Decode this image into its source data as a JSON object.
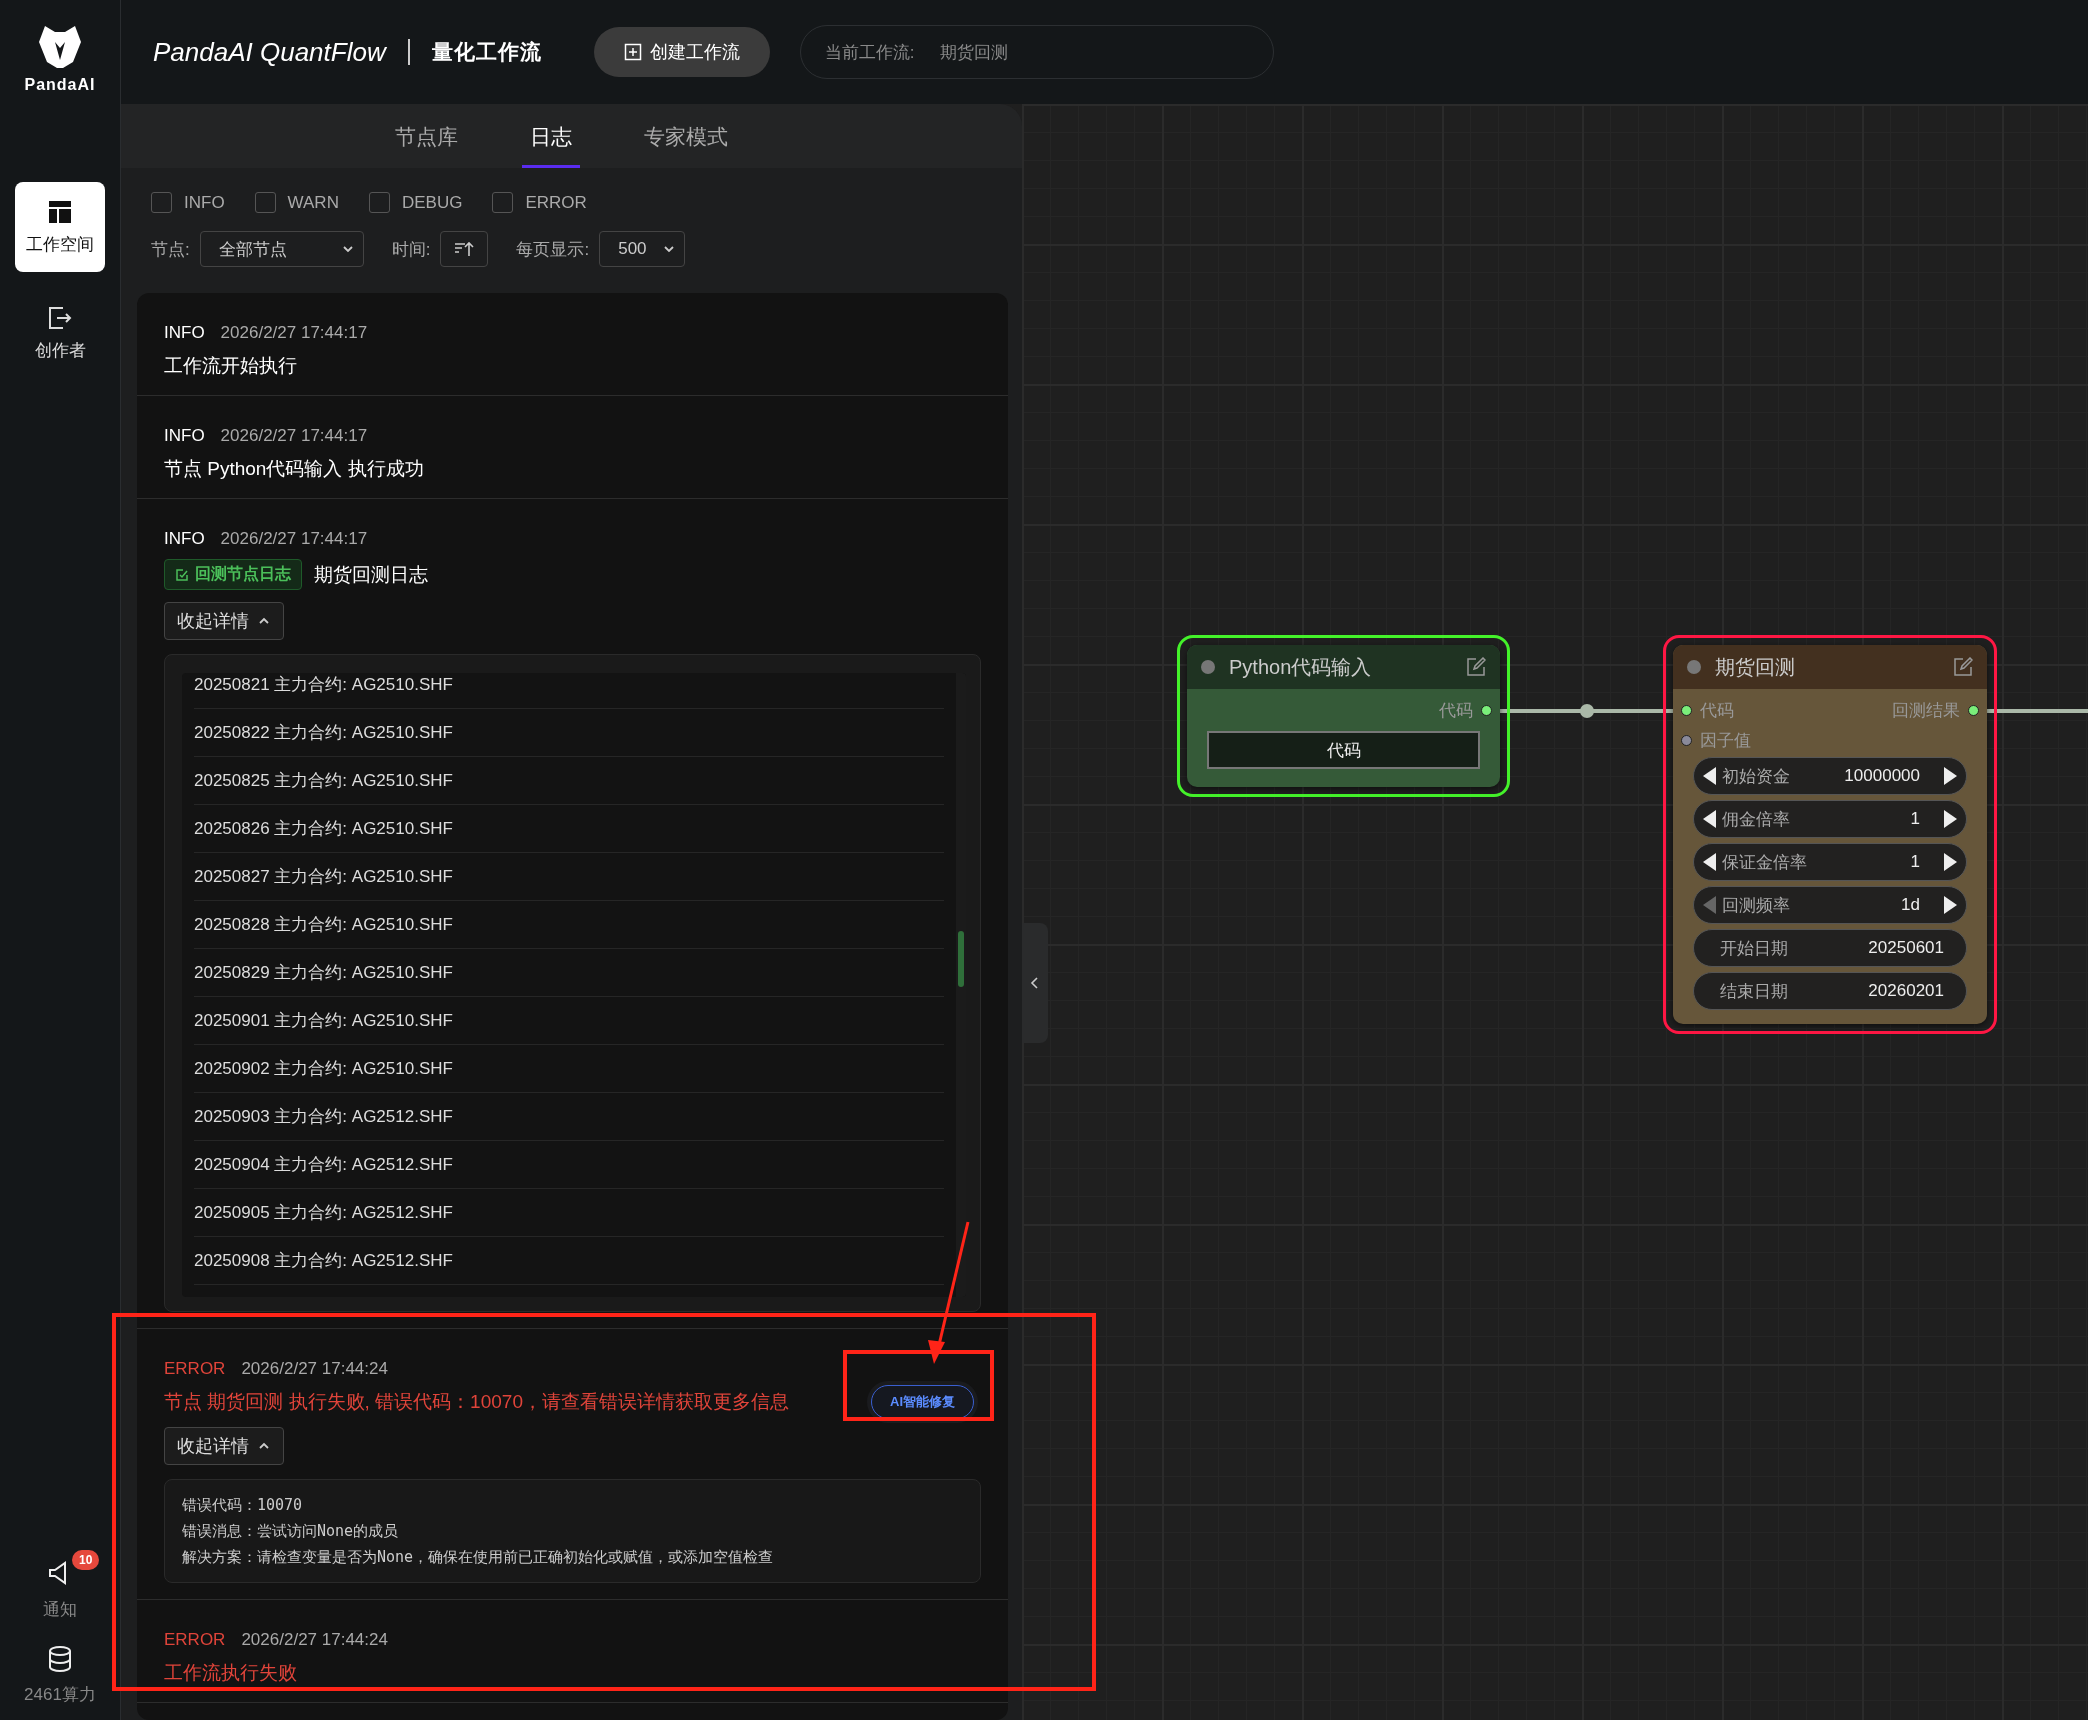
{
  "sidebar": {
    "logo": "PandaAI",
    "items": [
      {
        "label": "工作空间",
        "selected": true
      },
      {
        "label": "创作者",
        "selected": false
      }
    ],
    "notifications": {
      "label": "通知",
      "badge": "10"
    },
    "compute": {
      "label": "2461算力"
    }
  },
  "header": {
    "title": "PandaAI QuantFlow",
    "subtitle": "量化工作流",
    "create_button": "创建工作流",
    "current": {
      "label": "当前工作流:",
      "value": "期货回测"
    }
  },
  "panel": {
    "tabs": [
      {
        "label": "节点库",
        "selected": false
      },
      {
        "label": "日志",
        "selected": true
      },
      {
        "label": "专家模式",
        "selected": false
      }
    ],
    "level_filters": [
      {
        "label": "INFO",
        "checked": false
      },
      {
        "label": "WARN",
        "checked": false
      },
      {
        "label": "DEBUG",
        "checked": false
      },
      {
        "label": "ERROR",
        "checked": false
      }
    ],
    "node_filter": {
      "label": "节点:",
      "value": "全部节点"
    },
    "time_sort": {
      "label": "时间:"
    },
    "page_size": {
      "label": "每页显示:",
      "value": "500"
    },
    "logs": [
      {
        "level": "INFO",
        "time": "2026/2/27 17:44:17",
        "message": "工作流开始执行"
      },
      {
        "level": "INFO",
        "time": "2026/2/27 17:44:17",
        "message": "节点 Python代码输入 执行成功"
      },
      {
        "level": "INFO",
        "time": "2026/2/27 17:44:17",
        "tag": "回测节点日志",
        "message": "期货回测日志",
        "toggle": "收起详情",
        "detail_lines": [
          "20250821 主力合约: AG2510.SHF",
          "20250822 主力合约: AG2510.SHF",
          "20250825 主力合约: AG2510.SHF",
          "20250826 主力合约: AG2510.SHF",
          "20250827 主力合约: AG2510.SHF",
          "20250828 主力合约: AG2510.SHF",
          "20250829 主力合约: AG2510.SHF",
          "20250901 主力合约: AG2510.SHF",
          "20250902 主力合约: AG2510.SHF",
          "20250903 主力合约: AG2512.SHF",
          "20250904 主力合约: AG2512.SHF",
          "20250905 主力合约: AG2512.SHF",
          "20250908 主力合约: AG2512.SHF"
        ]
      },
      {
        "level": "ERROR",
        "time": "2026/2/27 17:44:24",
        "message": "节点 期货回测 执行失败, 错误代码：10070，请查看错误详情获取更多信息",
        "fix_button": "AI智能修复",
        "toggle": "收起详情",
        "error_details": [
          "错误代码：10070",
          "错误消息：尝试访问None的成员",
          "解决方案：请检查变量是否为None，确保在使用前已正确初始化或赋值，或添加空值检查"
        ]
      },
      {
        "level": "ERROR",
        "time": "2026/2/27 17:44:24",
        "message": "工作流执行失败"
      }
    ]
  },
  "canvas": {
    "nodes": [
      {
        "kind": "code",
        "color": "#44f22a",
        "title": "Python代码输入",
        "outputs": [
          {
            "label": "代码"
          }
        ],
        "button": "代码"
      },
      {
        "kind": "backtest",
        "color": "#ff1744",
        "title": "期货回测",
        "inputs": [
          {
            "label": "代码",
            "connected": true
          },
          {
            "label": "因子值",
            "connected": false
          }
        ],
        "outputs": [
          {
            "label": "回测结果"
          }
        ],
        "params": [
          {
            "kind": "stepper",
            "label": "初始资金",
            "value": "10000000",
            "decrement_disabled": false
          },
          {
            "kind": "stepper",
            "label": "佣金倍率",
            "value": "1",
            "decrement_disabled": false
          },
          {
            "kind": "stepper",
            "label": "保证金倍率",
            "value": "1",
            "decrement_disabled": false
          },
          {
            "kind": "stepper",
            "label": "回测频率",
            "value": "1d",
            "decrement_disabled": true
          },
          {
            "kind": "field",
            "label": "开始日期",
            "value": "20250601"
          },
          {
            "kind": "field",
            "label": "结束日期",
            "value": "20260201"
          }
        ]
      }
    ]
  }
}
